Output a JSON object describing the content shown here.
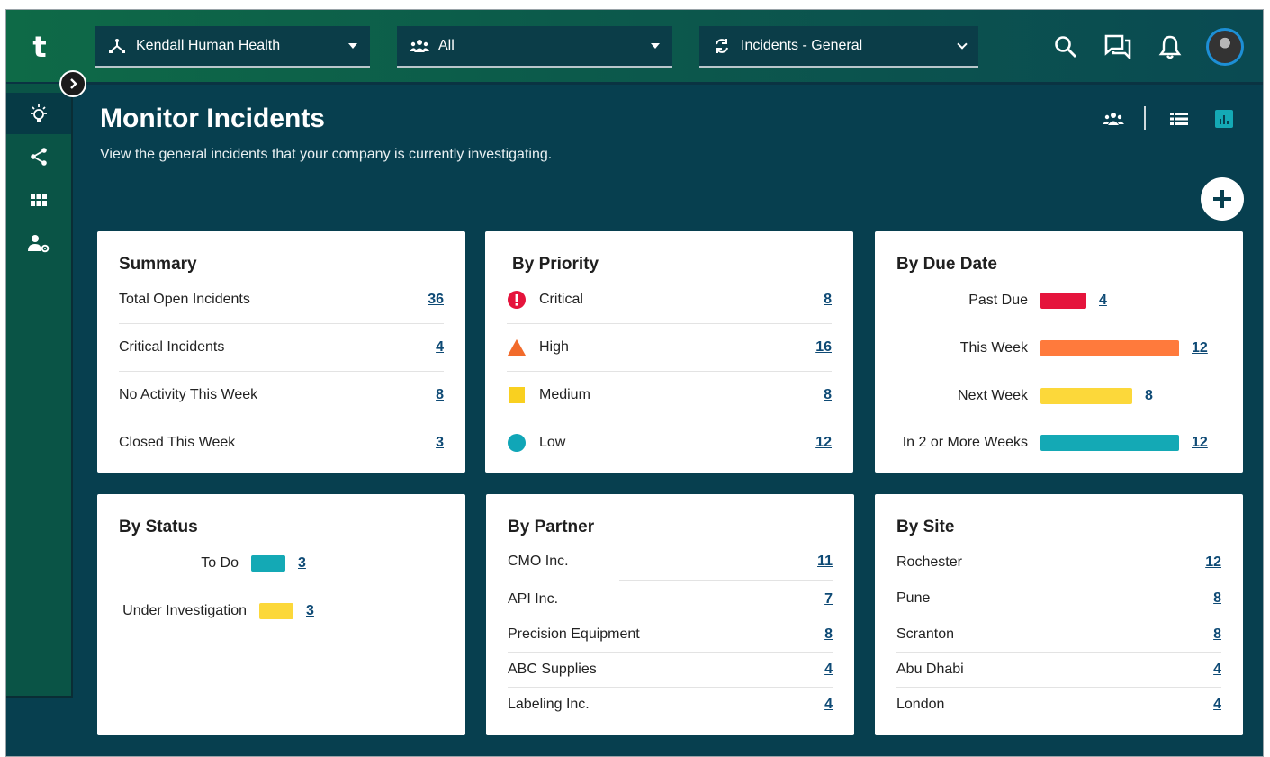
{
  "topbar": {
    "logo": "t",
    "company_select": {
      "value": "Kendall Human Health",
      "icon": "org-chart-icon"
    },
    "group_select": {
      "value": "All",
      "icon": "people-icon"
    },
    "module_select": {
      "value": "Incidents - General",
      "icon": "sync-icon"
    },
    "icons": [
      "search-icon",
      "chat-icon",
      "bell-icon",
      "avatar"
    ]
  },
  "sidebar": {
    "items": [
      "lightbulb-icon",
      "share-icon",
      "grid-icon",
      "user-settings-icon"
    ],
    "active": "lightbulb-icon"
  },
  "page": {
    "title": "Monitor Incidents",
    "subtitle": "View the general incidents that your company is currently investigating.",
    "view_icons": [
      "people-view-icon",
      "list-view-icon",
      "chart-view-icon"
    ],
    "active_view": "chart-view-icon"
  },
  "summary": {
    "title": "Summary",
    "rows": [
      {
        "label": "Total Open Incidents",
        "value": "36"
      },
      {
        "label": "Critical Incidents",
        "value": "4"
      },
      {
        "label": "No Activity This Week",
        "value": "8"
      },
      {
        "label": "Closed This Week",
        "value": "3"
      }
    ]
  },
  "priority": {
    "title": "By Priority",
    "rows": [
      {
        "label": "Critical",
        "value": "8",
        "icon": "critical-icon",
        "color": "#e5143c"
      },
      {
        "label": "High",
        "value": "16",
        "icon": "triangle-icon",
        "color": "#f26b2b"
      },
      {
        "label": "Medium",
        "value": "8",
        "icon": "square-icon",
        "color": "#f9d020"
      },
      {
        "label": "Low",
        "value": "12",
        "icon": "circle-icon",
        "color": "#10a6b7"
      }
    ]
  },
  "due_date": {
    "title": "By Due Date",
    "rows": [
      {
        "label": "Past Due",
        "value": "4",
        "color": "#e5143c"
      },
      {
        "label": "This Week",
        "value": "12",
        "color": "#ff7a3c"
      },
      {
        "label": "Next Week",
        "value": "8",
        "color": "#fcd83a"
      },
      {
        "label": "In 2 or More Weeks",
        "value": "12",
        "color": "#14a9b5"
      }
    ]
  },
  "status": {
    "title": "By Status",
    "rows": [
      {
        "label": "To Do",
        "value": "3",
        "color": "#14a9b5"
      },
      {
        "label": "Under Investigation",
        "value": "3",
        "color": "#fcd83a"
      }
    ]
  },
  "partner": {
    "title": "By Partner",
    "rows": [
      {
        "label": "CMO Inc.",
        "value": "11"
      },
      {
        "label": "API Inc.",
        "value": "7"
      },
      {
        "label": "Precision Equipment",
        "value": "8"
      },
      {
        "label": "ABC Supplies",
        "value": "4"
      },
      {
        "label": "Labeling Inc.",
        "value": "4"
      }
    ]
  },
  "site": {
    "title": "By Site",
    "rows": [
      {
        "label": "Rochester",
        "value": "12"
      },
      {
        "label": "Pune",
        "value": "8"
      },
      {
        "label": "Scranton",
        "value": "8"
      },
      {
        "label": "Abu Dhabi",
        "value": "4"
      },
      {
        "label": "London",
        "value": "4"
      }
    ]
  }
}
